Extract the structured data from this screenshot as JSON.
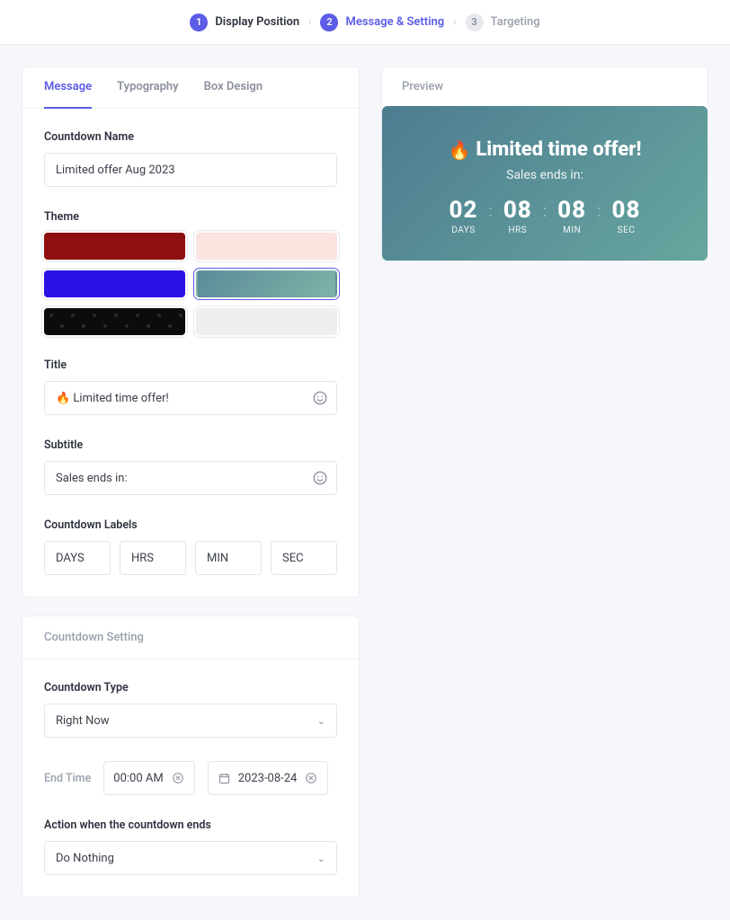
{
  "stepper": {
    "steps": [
      {
        "num": "1",
        "label": "Display Position"
      },
      {
        "num": "2",
        "label": "Message & Setting"
      },
      {
        "num": "3",
        "label": "Targeting"
      }
    ]
  },
  "tabs": {
    "message": "Message",
    "typography": "Typography",
    "box_design": "Box Design"
  },
  "form": {
    "countdown_name_label": "Countdown Name",
    "countdown_name_value": "Limited offer Aug 2023",
    "theme_label": "Theme",
    "title_label": "Title",
    "title_value": "🔥 Limited time offer!",
    "subtitle_label": "Subtitle",
    "subtitle_value": "Sales ends in:",
    "countdown_labels_label": "Countdown Labels",
    "labels": {
      "days": "DAYS",
      "hrs": "HRS",
      "min": "MIN",
      "sec": "SEC"
    }
  },
  "settings": {
    "header": "Countdown Setting",
    "type_label": "Countdown Type",
    "type_value": "Right Now",
    "end_time_label": "End Time",
    "end_time_value": "00:00 AM",
    "end_date_value": "2023-08-24",
    "action_label": "Action when the countdown ends",
    "action_value": "Do Nothing"
  },
  "preview": {
    "header": "Preview",
    "title": "Limited time offer!",
    "subtitle": "Sales ends in:",
    "days_num": "02",
    "days_lbl": "DAYS",
    "hrs_num": "08",
    "hrs_lbl": "HRS",
    "min_num": "08",
    "min_lbl": "MIN",
    "sec_num": "08",
    "sec_lbl": "SEC"
  }
}
